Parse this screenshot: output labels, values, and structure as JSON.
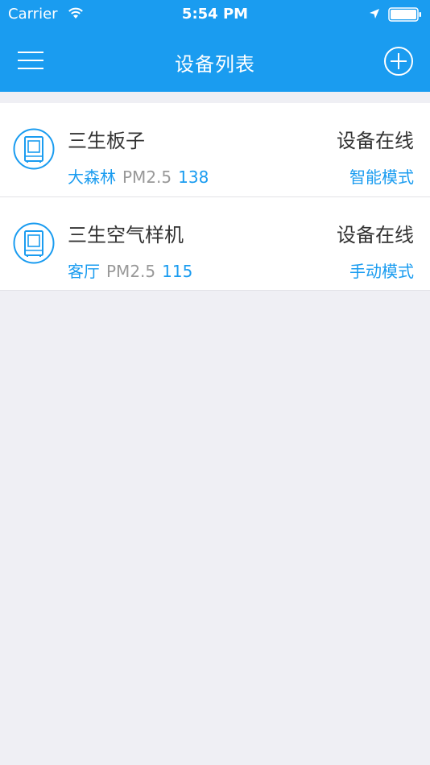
{
  "status_bar": {
    "carrier": "Carrier",
    "time": "5:54 PM",
    "icons": [
      "wifi-icon",
      "location-icon",
      "battery-icon"
    ]
  },
  "nav": {
    "title": "设备列表",
    "menu_icon": "menu-icon",
    "add_icon": "add-circle-icon"
  },
  "colors": {
    "accent": "#1a9cf0",
    "background": "#efeff4",
    "text": "#333333",
    "muted": "#999999"
  },
  "devices": [
    {
      "name": "三生板子",
      "status": "设备在线",
      "location": "大森林",
      "pm_label": "PM2.5",
      "pm_value": "138",
      "mode": "智能模式",
      "icon": "air-purifier-icon"
    },
    {
      "name": "三生空气样机",
      "status": "设备在线",
      "location": "客厅",
      "pm_label": "PM2.5",
      "pm_value": "115",
      "mode": "手动模式",
      "icon": "air-purifier-icon"
    }
  ]
}
